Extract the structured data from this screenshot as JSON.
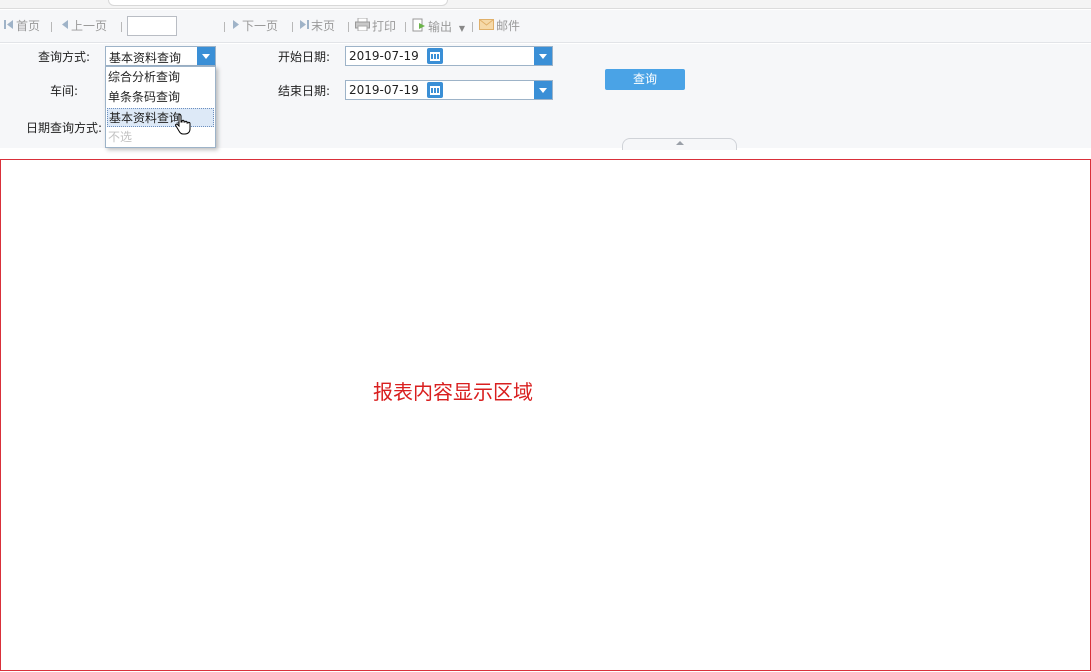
{
  "toolbar": {
    "first_page": "首页",
    "prev_page": "上一页",
    "page_number": "",
    "next_page": "下一页",
    "last_page": "末页",
    "print": "打印",
    "export": "输出",
    "mail": "邮件"
  },
  "query": {
    "query_mode_label": "查询方式:",
    "query_mode_value": "基本资料查询",
    "workshop_label": "车间:",
    "date_mode_label": "日期查询方式:",
    "start_date_label": "开始日期:",
    "start_date_value": "2019-07-19",
    "end_date_label": "结束日期:",
    "end_date_value": "2019-07-19",
    "query_button": "查询"
  },
  "dropdown": {
    "options": [
      "综合分析查询",
      "单条条码查询",
      "基本资料查询",
      "不选"
    ],
    "hovered_index": 2
  },
  "report": {
    "placeholder": "报表内容显示区域"
  },
  "colors": {
    "accent": "#3a8fd6",
    "button": "#4aa3e6",
    "report_border": "#d9303a",
    "report_text": "#d91f1f"
  }
}
